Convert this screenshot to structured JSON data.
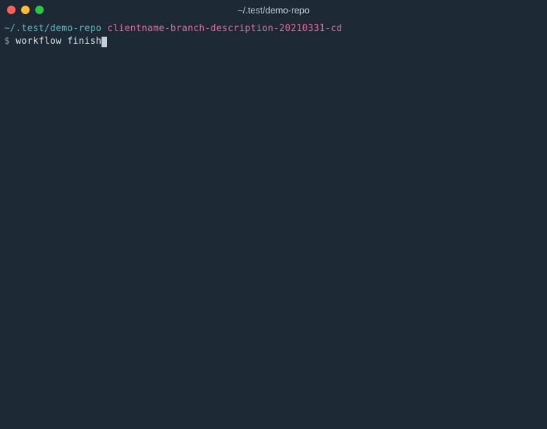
{
  "window": {
    "title": "~/.test/demo-repo"
  },
  "prompt_line": {
    "cwd": "~/.test/demo-repo",
    "git_icon": "",
    "branch": "clientname-branch-description-20210331-cd"
  },
  "command_line": {
    "symbol": "$",
    "command": "workflow finish"
  },
  "colors": {
    "background": "#1e2936",
    "cyan": "#56b6c2",
    "pink": "#e06c9b",
    "white": "#e6e6e6",
    "yellow": "#d9b96e"
  }
}
